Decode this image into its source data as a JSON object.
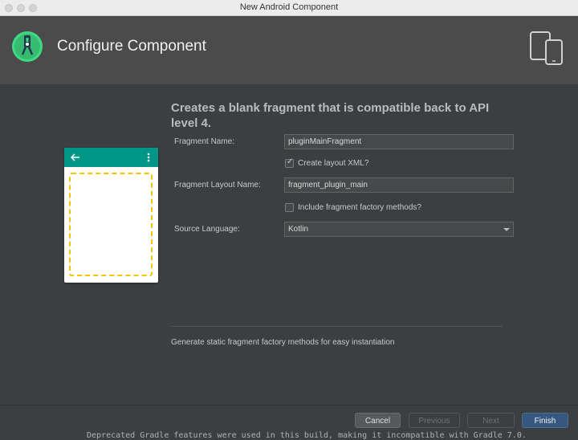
{
  "window": {
    "title": "New Android Component"
  },
  "header": {
    "title": "Configure Component"
  },
  "heading": "Creates a blank fragment that is compatible back to API level 4.",
  "form": {
    "fragment_name_label": "Fragment Name:",
    "fragment_name_value": "pluginMainFragment",
    "create_layout_label": "Create layout XML?",
    "create_layout_checked": true,
    "layout_name_label": "Fragment Layout Name:",
    "layout_name_value": "fragment_plugin_main",
    "factory_methods_label": "Include fragment factory methods?",
    "factory_methods_checked": false,
    "source_language_label": "Source Language:",
    "source_language_value": "Kotlin"
  },
  "description": "Generate static fragment factory methods for easy instantiation",
  "buttons": {
    "cancel": "Cancel",
    "previous": "Previous",
    "next": "Next",
    "finish": "Finish"
  },
  "console_text": "Deprecated Gradle features were used in this build, making it incompatible with Gradle 7.0.",
  "colors": {
    "accent": "#365880",
    "preview_bar": "#009688",
    "preview_frame": "#f5c400"
  },
  "icons": [
    "android-studio-logo-icon",
    "devices-icon",
    "back-arrow-icon",
    "overflow-menu-icon",
    "checkmark-icon",
    "dropdown-arrow-icon"
  ]
}
